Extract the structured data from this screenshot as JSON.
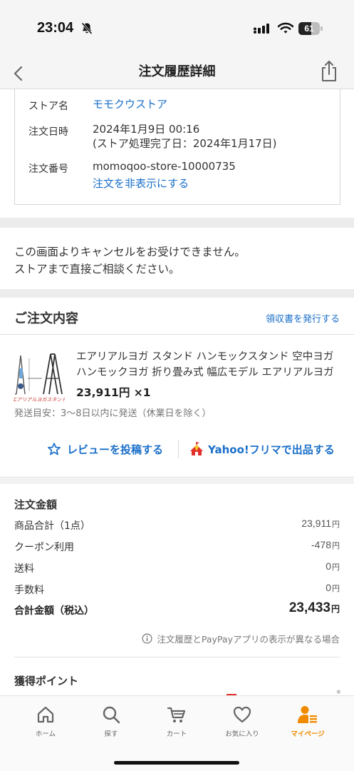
{
  "status_bar": {
    "time": "23:04",
    "battery": "61",
    "battery_level": 0.61
  },
  "nav": {
    "title": "注文履歴詳細"
  },
  "store_info": {
    "store_name_label": "ストア名",
    "store_name": "モモクウストア",
    "order_date_label": "注文日時",
    "order_date": "2024年1月9日 00:16",
    "processing_complete": "(ストア処理完了日：2024年1月17日)",
    "order_number_label": "注文番号",
    "order_number": "momoqoo-store-10000735",
    "hide_order_link": "注文を非表示にする"
  },
  "cancel_notice": {
    "line1": "この画面よりキャンセルをお受けできません。",
    "line2": "ストアまで直接ご相談ください。"
  },
  "order_contents": {
    "title": "ご注文内容",
    "receipt_link": "領収書を発行する",
    "product": {
      "name": "エアリアルヨガ スタンド ハンモックスタンド 空中ヨガ ハンモックヨガ 折り畳み式 幅広モデル エアリアルヨガスタンド",
      "thumb_caption": "エアリアルヨガスタンド",
      "price": "23,911円",
      "quantity": "×1"
    },
    "shipping_note": "発送目安：3〜8日以内に発送（休業日を除く）",
    "review_button": "レビューを投稿する",
    "flea_market_button": "Yahoo!フリマで出品する"
  },
  "amounts": {
    "title": "注文金額",
    "rows": [
      {
        "label": "商品合計（1点）",
        "value": "23,911",
        "unit": "円"
      },
      {
        "label": "クーポン利用",
        "value": "-478",
        "unit": "円"
      },
      {
        "label": "送料",
        "value": "0",
        "unit": "円"
      },
      {
        "label": "手数料",
        "value": "0",
        "unit": "円"
      }
    ],
    "total_label": "合計金額（税込）",
    "total_value": "23,433",
    "total_unit": "円",
    "display_note": "注文履歴とPayPayアプリの表示が異なる場合"
  },
  "points": {
    "title": "獲得ポイント"
  },
  "tabs": [
    {
      "label": "ホーム",
      "icon": "home-icon"
    },
    {
      "label": "探す",
      "icon": "search-icon"
    },
    {
      "label": "カート",
      "icon": "cart-icon"
    },
    {
      "label": "お気に入り",
      "icon": "heart-icon"
    },
    {
      "label": "マイページ",
      "icon": "mypage-icon",
      "active": true
    }
  ],
  "colors": {
    "link": "#1a6fc9",
    "accent": "#f08a00",
    "flea_red": "#e0302a"
  }
}
